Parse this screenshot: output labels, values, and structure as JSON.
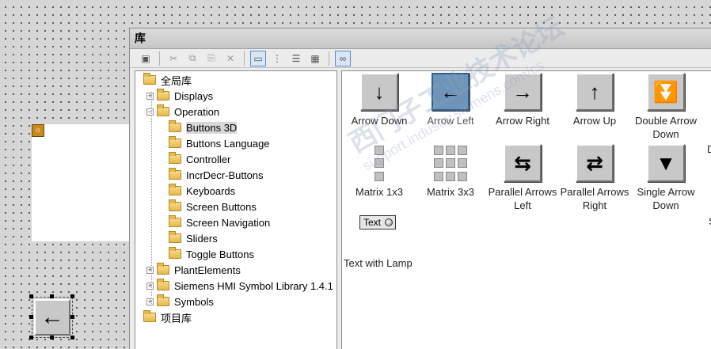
{
  "window": {
    "title": "库"
  },
  "toolbar": {
    "buttons": [
      {
        "name": "new-folder-button",
        "glyph": "▣",
        "state": "normal"
      },
      {
        "name": "cut-button",
        "glyph": "✂",
        "state": "disabled"
      },
      {
        "name": "copy-button",
        "glyph": "⧉",
        "state": "disabled"
      },
      {
        "name": "paste-button",
        "glyph": "⎘",
        "state": "disabled"
      },
      {
        "name": "delete-button",
        "glyph": "✕",
        "state": "disabled"
      },
      {
        "name": "view-large-icons-button",
        "glyph": "▭",
        "state": "active"
      },
      {
        "name": "view-small-icons-button",
        "glyph": "⋮",
        "state": "normal"
      },
      {
        "name": "view-list-button",
        "glyph": "☰",
        "state": "normal"
      },
      {
        "name": "view-details-button",
        "glyph": "▦",
        "state": "normal"
      },
      {
        "name": "show-preview-button",
        "glyph": "∞",
        "state": "active"
      }
    ]
  },
  "tree": {
    "items": [
      {
        "label": "全局库",
        "level": 0,
        "expander": ""
      },
      {
        "label": "Displays",
        "level": 1,
        "expander": "+"
      },
      {
        "label": "Operation",
        "level": 1,
        "expander": "−"
      },
      {
        "label": "Buttons 3D",
        "level": 2,
        "expander": "",
        "selected": true
      },
      {
        "label": "Buttons Language",
        "level": 2,
        "expander": ""
      },
      {
        "label": "Controller",
        "level": 2,
        "expander": ""
      },
      {
        "label": "IncrDecr-Buttons",
        "level": 2,
        "expander": ""
      },
      {
        "label": "Keyboards",
        "level": 2,
        "expander": ""
      },
      {
        "label": "Screen Buttons",
        "level": 2,
        "expander": ""
      },
      {
        "label": "Screen Navigation",
        "level": 2,
        "expander": ""
      },
      {
        "label": "Sliders",
        "level": 2,
        "expander": ""
      },
      {
        "label": "Toggle Buttons",
        "level": 2,
        "expander": ""
      },
      {
        "label": "PlantElements",
        "level": 1,
        "expander": "+"
      },
      {
        "label": "Siemens HMI Symbol Library 1.4.1",
        "level": 1,
        "expander": "+"
      },
      {
        "label": "Symbols",
        "level": 1,
        "expander": "+"
      },
      {
        "label": "项目库",
        "level": 0,
        "expander": ""
      }
    ]
  },
  "content": {
    "items": [
      {
        "label": "Arrow Down",
        "icon": "arrow-down-icon",
        "glyph": "↓"
      },
      {
        "label": "Arrow Left",
        "icon": "arrow-left-icon",
        "glyph": "←",
        "selected": true
      },
      {
        "label": "Arrow Right",
        "icon": "arrow-right-icon",
        "glyph": "→"
      },
      {
        "label": "Arrow Up",
        "icon": "arrow-up-icon",
        "glyph": "↑"
      },
      {
        "label": "Double Arrow Down",
        "icon": "double-arrow-down-icon",
        "glyph": "⏬"
      },
      {
        "label": "Matrix 1x3",
        "icon": "matrix-1x3-icon",
        "glyph": ""
      },
      {
        "label": "Matrix 3x3",
        "icon": "matrix-3x3-icon",
        "glyph": ""
      },
      {
        "label": "Parallel Arrows Left",
        "icon": "parallel-arrows-left-icon",
        "glyph": "⇆"
      },
      {
        "label": "Parallel Arrows Right",
        "icon": "parallel-arrows-right-icon",
        "glyph": "⇄"
      },
      {
        "label": "Single Arrow Down",
        "icon": "single-arrow-down-icon",
        "glyph": "▼"
      },
      {
        "label": "Text with Lamp",
        "icon": "text-with-lamp-icon",
        "glyph": "",
        "button_text": "Text"
      }
    ],
    "partial_labels": [
      "D",
      "S"
    ]
  },
  "canvas": {
    "button_glyph": "←"
  },
  "watermark": {
    "main": "西门子工业技术论坛",
    "sub": "support.industry.siemens.com/cs"
  },
  "colors": {
    "selected_icon": "#6e95b8",
    "canvas_dots": "#3a3a3a"
  }
}
